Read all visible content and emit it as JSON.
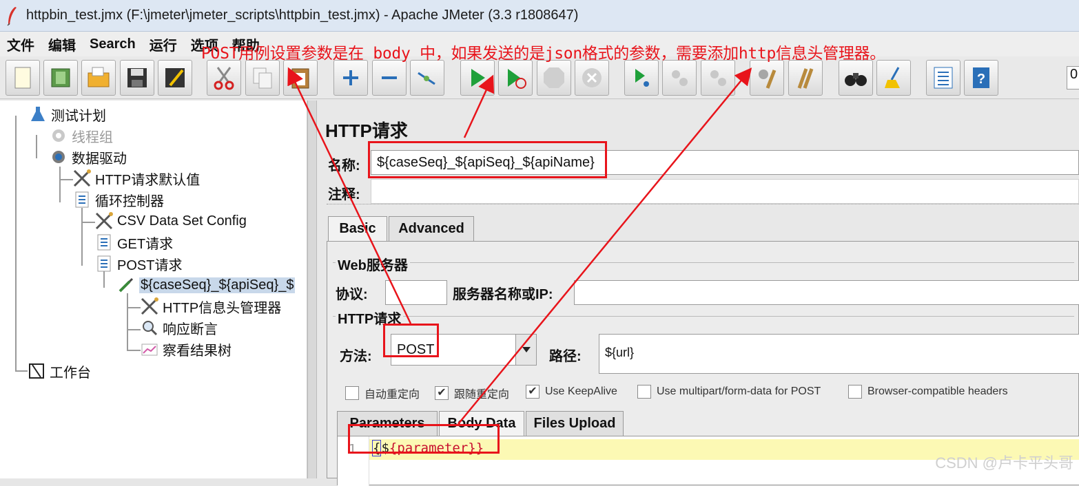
{
  "window": {
    "title": "httpbin_test.jmx (F:\\jmeter\\jmeter_scripts\\httpbin_test.jmx) - Apache JMeter (3.3 r1808647)"
  },
  "menu": [
    "文件",
    "编辑",
    "Search",
    "运行",
    "选项",
    "帮助"
  ],
  "annotation": "POST用例设置参数是在 body 中，如果发送的是json格式的参数，需要添加http信息头管理器。",
  "toolbar": {
    "buttons": [
      "new-icon",
      "templates-icon",
      "open-icon",
      "save-icon",
      "save-as-icon",
      "cut-icon",
      "copy-icon",
      "paste-icon",
      "expand-icon",
      "collapse-icon",
      "toggle-icon",
      "start-icon",
      "start-no-pause-icon",
      "stop-icon",
      "shutdown-icon",
      "remote-start-icon",
      "remote-stop-icon",
      "remote-shutdown-icon",
      "clear-icon",
      "clear-all-icon",
      "search-icon",
      "reset-search-icon",
      "function-helper-icon",
      "help-icon"
    ],
    "counter": "0"
  },
  "tree": {
    "nodes": [
      {
        "label": "测试计划",
        "icon": "flask-icon"
      },
      {
        "label": "线程组",
        "icon": "gear-icon"
      },
      {
        "label": "数据驱动",
        "icon": "gear-icon"
      },
      {
        "label": "HTTP请求默认值",
        "icon": "wrench-icon"
      },
      {
        "label": "循环控制器",
        "icon": "controller-icon"
      },
      {
        "label": "CSV Data Set Config",
        "icon": "wrench-icon"
      },
      {
        "label": "GET请求",
        "icon": "controller-icon"
      },
      {
        "label": "POST请求",
        "icon": "controller-icon"
      },
      {
        "label": "${caseSeq}_${apiSeq}_$",
        "icon": "pipette-icon"
      },
      {
        "label": "HTTP信息头管理器",
        "icon": "wrench-icon"
      },
      {
        "label": "响应断言",
        "icon": "magnifier-icon"
      },
      {
        "label": "察看结果树",
        "icon": "graph-icon"
      },
      {
        "label": "工作台",
        "icon": "workbench-icon"
      }
    ]
  },
  "panel": {
    "title": "HTTP请求",
    "name_label": "名称:",
    "name_value": "${caseSeq}_${apiSeq}_${apiName}",
    "comment_label": "注释:",
    "comment_value": "",
    "tabs": [
      "Basic",
      "Advanced"
    ],
    "web_server": {
      "group": "Web服务器",
      "protocol_label": "协议:",
      "protocol_value": "",
      "server_label": "服务器名称或IP:",
      "server_value": ""
    },
    "http_request": {
      "group": "HTTP请求",
      "method_label": "方法:",
      "method_value": "POST",
      "path_label": "路径:",
      "path_value": "${url}"
    },
    "options": [
      {
        "label": "自动重定向",
        "checked": false
      },
      {
        "label": "跟随重定向",
        "checked": true
      },
      {
        "label": "Use KeepAlive",
        "checked": true
      },
      {
        "label": "Use multipart/form-data for POST",
        "checked": false
      },
      {
        "label": "Browser-compatible headers",
        "checked": false
      }
    ],
    "subtabs": [
      "Parameters",
      "Body Data",
      "Files Upload"
    ],
    "body": {
      "line_number": "1",
      "open": "{",
      "dollar": "$",
      "var": "{parameter}",
      "close": "}"
    }
  },
  "watermark": "CSDN @卢卡平头哥",
  "colors": {
    "annotation": "#e8141b",
    "selection": "#c8d8ea",
    "highlight": "#fcf9b4"
  }
}
